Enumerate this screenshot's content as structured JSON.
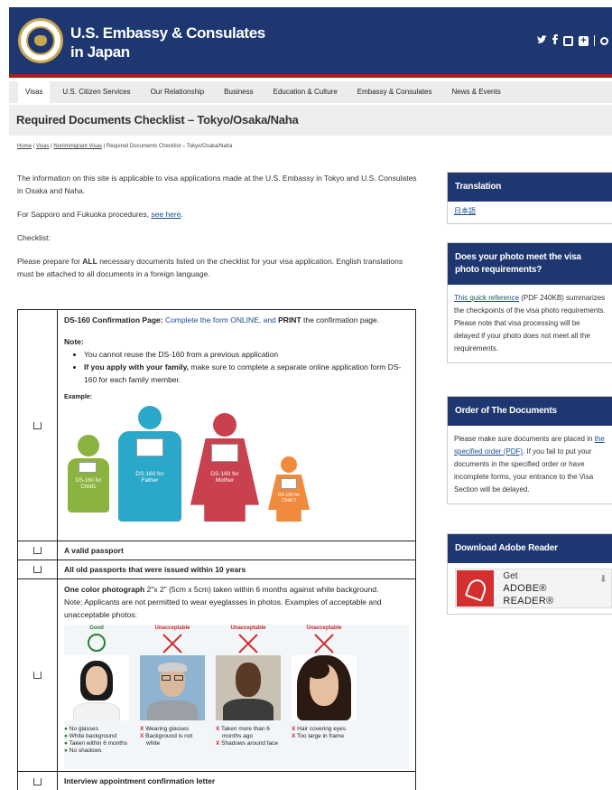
{
  "header": {
    "title_line1": "U.S. Embassy & Consulates",
    "title_line2": "in Japan",
    "social": [
      "twitter-icon",
      "facebook-icon",
      "instagram-icon",
      "plus-icon",
      "search-icon"
    ]
  },
  "nav": {
    "items": [
      "Visas",
      "U.S. Citizen Services",
      "Our Relationship",
      "Business",
      "Education & Culture",
      "Embassy & Consulates",
      "News & Events"
    ]
  },
  "page": {
    "title": "Required Documents Checklist – Tokyo/Osaka/Naha",
    "breadcrumb": [
      "Home",
      "Visas",
      "Nonimmigrant Visas",
      "Required Documents Checklist – Tokyo/Osaka/Naha"
    ]
  },
  "intro": {
    "p1": "The information on this site is applicable to visa applications made at the U.S. Embassy in Tokyo and U.S. Consulates in Osaka and Naha.",
    "p2_prefix": "For Sapporo and Fukuoka procedures, ",
    "p2_link": "see here",
    "p2_suffix": ".",
    "p3": "Checklist:",
    "p4_a": "Please prepare for ",
    "p4_b": "ALL",
    "p4_c": " necessary documents listed on the checklist for your visa application. English translations must be attached to all documents in a foreign language."
  },
  "checklist": {
    "ds160_label": "DS-160 Confirmation Page:",
    "ds160_blue": " Complete the form ONLINE, and ",
    "ds160_print": "PRINT",
    "ds160_rest": " the confirmation page.",
    "note_label": "Note:",
    "note1": "You cannot reuse the DS-160 from a previous application",
    "note2_bold": "If you apply with your family,",
    "note2_rest": " make sure to complete a separate online application form DS-160 for each family member.",
    "example_label": "Example:",
    "figure_labels": {
      "child1": "DS-160 for Child1",
      "father": "DS-160 for Father",
      "mother": "DS-160 for Mother",
      "child2": "DS-160 for Child 2"
    },
    "passport": "A valid passport",
    "old_passports": "All old passports that were issued within 10 years",
    "photo_bold": "One color photograph",
    "photo_rest": " 2\"x 2\" (5cm x 5cm) taken within 6 months against white background.",
    "photo_note": "Note: Applicants are not permitted to wear eyeglasses in photos. Examples of acceptable and unacceptable photos:",
    "photo_examples": [
      {
        "head": "Good",
        "items": [
          "No glasses",
          "White background",
          "Taken within 6 months",
          "No shadows"
        ]
      },
      {
        "head": "Unacceptable",
        "items": [
          "Wearing glasses",
          "Background is not white"
        ]
      },
      {
        "head": "Unacceptable",
        "items": [
          "Taken more than 6 months ago",
          "Shadows around face"
        ]
      },
      {
        "head": "Unacceptable",
        "items": [
          "Hair covering eyes",
          "Too large in frame"
        ]
      }
    ],
    "interview": "Interview appointment confirmation letter"
  },
  "sidebar": {
    "translation_title": "Translation",
    "translation_link": "日本語",
    "photo_title": "Does your photo meet the visa photo requirements?",
    "photo_link": "This quick reference",
    "photo_text": " (PDF 240KB) summarizes the checkpoints of the visa photo requirements. Please note that visa processing will be delayed if your photo does not meet all the requirements.",
    "order_title": "Order of The Documents",
    "order_text1": "Please make sure documents are placed in ",
    "order_link": "the specified order (PDF)",
    "order_text2": ". If you fail to put your documents in the specified order or have incomplete forms, your entrance to the Visa Section will be delayed.",
    "adobe_title": "Download Adobe Reader",
    "adobe_get": "Get",
    "adobe_name": "ADOBE® READER®"
  },
  "colors": {
    "header_bg": "#1e3770",
    "header_stripe": "#b31b1b",
    "link": "#1a4d8f",
    "child1": "#8bb33f",
    "father": "#2aa7c9",
    "mother": "#c9404e",
    "child2": "#f08a3c"
  }
}
